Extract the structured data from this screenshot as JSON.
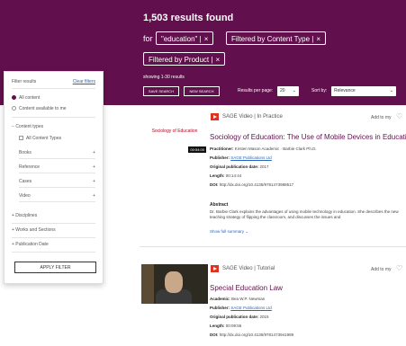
{
  "header": {
    "results_count": "1,503 results found",
    "for_label": "for",
    "chips": [
      {
        "label": "\"education\" |",
        "close": "×"
      },
      {
        "label": "Filtered by Content Type |",
        "close": "×"
      },
      {
        "label": "Filtered by Product |",
        "close": "×"
      }
    ],
    "showing": "showing 1-30 results",
    "save_search": "SAVE SEARCH",
    "new_search": "NEW SEARCH",
    "per_page_label": "Results per page:",
    "per_page_value": "20",
    "sort_label": "Sort by:",
    "sort_value": "Relevance"
  },
  "filters": {
    "title": "Filter results",
    "clear": "Clear filters",
    "availability": [
      {
        "label": "All content",
        "selected": true
      },
      {
        "label": "Content available to me",
        "selected": false
      }
    ],
    "content_type_header": "Content types",
    "all_content_types": "All Content Types",
    "types": [
      {
        "label": "Books",
        "icon": "+"
      },
      {
        "label": "Reference",
        "icon": "+"
      },
      {
        "label": "Cases",
        "icon": "+"
      },
      {
        "label": "Video",
        "icon": "+"
      }
    ],
    "sections": [
      {
        "label": "+  Disciplines"
      },
      {
        "label": "+  Works and Sections"
      },
      {
        "label": "+  Publication Date"
      }
    ],
    "apply": "APPLY FILTER"
  },
  "results": [
    {
      "thumb_text": "Sociology of Education",
      "thumb_tag": "00:54:00",
      "type": "SAGE Video | In Practice",
      "add_to": "Add to my",
      "title": "Sociology of Education: The Use of Mobile Devices in Education",
      "meta": [
        {
          "k": "Practitioner:",
          "v": "Kirsten Mason Academic · Barbie Clark Ph.D."
        },
        {
          "k": "Publisher:",
          "v": "SAGE Publications Ltd",
          "link": true
        },
        {
          "k": "Original publication date:",
          "v": "2017"
        },
        {
          "k": "Length:",
          "v": "00:14:44"
        },
        {
          "k": "DOI:",
          "v": "http://dx.doi.org/10.4135/9781473988517"
        }
      ],
      "abstract_title": "Abstract",
      "abstract": "Dr. Barbie Clark explains the advantages of using mobile technology in education. She describes the new teaching strategy of flipping the classroom, and discusses the issues and",
      "show_full": "Show full summary ⌄"
    },
    {
      "type": "SAGE Video | Tutorial",
      "add_to": "Add to my",
      "title": "Special Education Law",
      "meta": [
        {
          "k": "Academic:",
          "v": "Bea W.P. Newman"
        },
        {
          "k": "Publisher:",
          "v": "SAGE Publications Ltd",
          "link": true
        },
        {
          "k": "Original publication date:",
          "v": "2015"
        },
        {
          "k": "Length:",
          "v": "00:09:56"
        },
        {
          "k": "DOI:",
          "v": "http://dx.doi.org/10.4135/9781473941989"
        }
      ]
    }
  ],
  "colors": {
    "brand": "#62104d",
    "play": "#d32222",
    "link": "#2a66b8"
  }
}
